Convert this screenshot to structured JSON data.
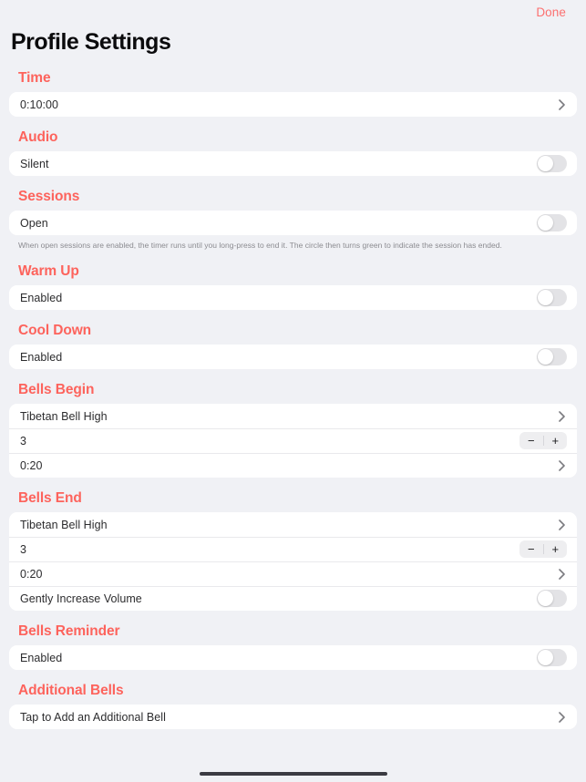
{
  "navbar": {
    "done_label": "Done"
  },
  "page_title": "Profile Settings",
  "colors": {
    "accent": "#fd635c",
    "done": "#fc7070",
    "background": "#f0f1f5",
    "card": "#ffffff",
    "label": "#2c2c2e",
    "footnote": "#8b8b90",
    "toggle_off_track": "#e3e3e6",
    "stepper_background": "#eeeef0"
  },
  "sections": [
    {
      "header": "Time",
      "rows": [
        {
          "label": "0:10:00",
          "accessory": "chevron"
        }
      ]
    },
    {
      "header": "Audio",
      "rows": [
        {
          "label": "Silent",
          "accessory": "toggle",
          "toggle_on": false
        }
      ]
    },
    {
      "header": "Sessions",
      "rows": [
        {
          "label": "Open",
          "accessory": "toggle",
          "toggle_on": false
        }
      ],
      "footnote": "When open sessions are enabled, the timer runs until you long-press to end it. The circle then turns green to indicate the session has ended."
    },
    {
      "header": "Warm Up",
      "rows": [
        {
          "label": "Enabled",
          "accessory": "toggle",
          "toggle_on": false
        }
      ]
    },
    {
      "header": "Cool Down",
      "rows": [
        {
          "label": "Enabled",
          "accessory": "toggle",
          "toggle_on": false
        }
      ]
    },
    {
      "header": "Bells Begin",
      "rows": [
        {
          "label": "Tibetan Bell High",
          "accessory": "chevron"
        },
        {
          "label": "3",
          "accessory": "stepper",
          "decrement_label": "−",
          "increment_label": "+"
        },
        {
          "label": "0:20",
          "accessory": "chevron"
        }
      ]
    },
    {
      "header": "Bells End",
      "rows": [
        {
          "label": "Tibetan Bell High",
          "accessory": "chevron"
        },
        {
          "label": "3",
          "accessory": "stepper",
          "decrement_label": "−",
          "increment_label": "+"
        },
        {
          "label": "0:20",
          "accessory": "chevron"
        },
        {
          "label": "Gently Increase Volume",
          "accessory": "toggle",
          "toggle_on": false
        }
      ]
    },
    {
      "header": "Bells Reminder",
      "rows": [
        {
          "label": "Enabled",
          "accessory": "toggle",
          "toggle_on": false
        }
      ]
    },
    {
      "header": "Additional Bells",
      "rows": [
        {
          "label": "Tap to Add an Additional Bell",
          "accessory": "chevron"
        }
      ]
    }
  ]
}
